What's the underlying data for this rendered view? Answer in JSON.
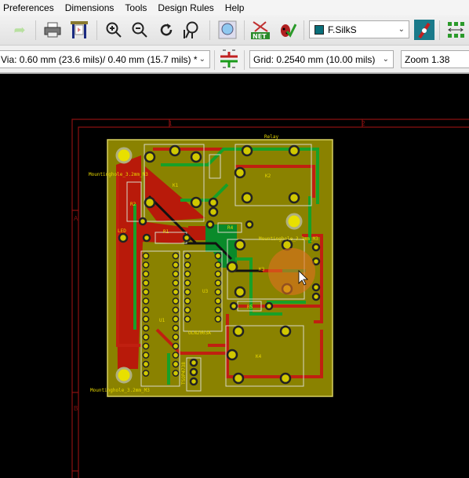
{
  "menu": [
    "Preferences",
    "Dimensions",
    "Tools",
    "Design Rules",
    "Help"
  ],
  "toolbar": {
    "icons": [
      "redo-icon",
      "print-icon",
      "plot-icon",
      "zoom-in-icon",
      "zoom-out-icon",
      "redraw-icon",
      "zoom-fit-icon",
      "find-icon",
      "netlist-icon",
      "drc-icon",
      "layer-pair-icon",
      "grid-icon"
    ],
    "layer_select": {
      "value": "F.SilkS",
      "swatch_color": "#0a6f7a"
    }
  },
  "toolbar2": {
    "via_select": "Via: 0.60 mm (23.6 mils)/ 0.40 mm (15.7 mils) *",
    "grid_select": "Grid: 0.2540 mm (10.00 mils)",
    "zoom_select": "Zoom 1.38"
  },
  "canvas": {
    "frame_labels": {
      "col1": "1",
      "col2": "2",
      "rowA": "A",
      "rowB": "B"
    },
    "labels": {
      "relay": "Relay",
      "mh_top": "Mountinghole_3.2mm_M3",
      "mh_right": "Mountinghole_3.2mm_M3",
      "mh_bottom": "Mountinghole_3.2mm_M3",
      "k1": "K1",
      "k2": "K2",
      "k3": "K3",
      "k4": "K4",
      "r1": "R1",
      "r2": "R2",
      "r4": "R4",
      "r5": "R5",
      "u1": "U1",
      "u3": "U3",
      "uln": "ULN2003A",
      "tsop": "TSOP4738",
      "led": "LED"
    },
    "colors": {
      "board": "#8a8200",
      "copper_front": "#b81a0a",
      "copper_back": "#0a9a2a",
      "silk": "#e8e0a0",
      "frame": "#8a1010",
      "highlight": "#e07020"
    }
  }
}
